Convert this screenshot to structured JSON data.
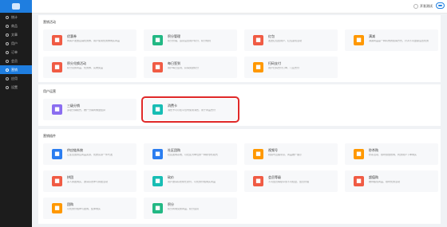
{
  "sidebar": {
    "items": [
      "统计",
      "商品",
      "文章",
      "用户",
      "订单",
      "会员",
      "营销",
      "应用",
      "设置"
    ],
    "active_index": 6
  },
  "topbar": {
    "user_label": "开发测试"
  },
  "sections": [
    {
      "title": "营销活动",
      "cards": [
        {
          "title": "优惠券",
          "desc": "向客户发放店铺优惠券，用户使用优惠券购买商品",
          "color": "#f05b44",
          "icon": "coupon-icon"
        },
        {
          "title": "积分管理",
          "desc": "积分管理，运营设置用户积分，积分规则",
          "color": "#22b884",
          "icon": "points-icon"
        },
        {
          "title": "红包",
          "desc": "发送红包给用户，红包返现活动",
          "color": "#f05b44",
          "icon": "red-packet-icon"
        },
        {
          "title": "满减",
          "desc": "满减商品是一种有效的促销方式，针对不同金额设置优惠",
          "color": "#ff9800",
          "icon": "full-reduction-icon"
        },
        {
          "title": "积分兑换活动",
          "desc": "积分兑换商品、优惠券、实物奖品",
          "color": "#f05b44",
          "icon": "exchange-icon"
        },
        {
          "title": "每日签到",
          "desc": "用户每日签到，获得奖励积分",
          "color": "#f05b44",
          "icon": "sign-in-icon"
        },
        {
          "title": "扫码支付",
          "desc": "用户扫码支付订单，门店支付",
          "color": "#ff9800",
          "icon": "scan-pay-icon"
        }
      ]
    },
    {
      "title": "用户运营",
      "cards": [
        {
          "title": "三级分销",
          "desc": "多级分销模式，推广分销商佣金结算",
          "color": "#8a6df0",
          "icon": "distribution-icon"
        },
        {
          "title": "消费卡",
          "desc": "消费卡可以在平台内使用消费，用于商品支付",
          "color": "#17bdb4",
          "icon": "consumption-card-icon"
        }
      ]
    },
    {
      "title": "营销插件",
      "cards": [
        {
          "title": "供应链系统",
          "desc": "汇集全国供应商品资源，优质货源一件代发",
          "color": "#2a7df0",
          "icon": "supply-chain-icon"
        },
        {
          "title": "社区团购",
          "desc": "社区团购系统，以社区为单位的一种新零售模式",
          "color": "#2a7df0",
          "icon": "community-icon"
        },
        {
          "title": "视频号",
          "desc": "视频号直播带货，商品推广展示",
          "color": "#ff9800",
          "icon": "video-icon"
        },
        {
          "title": "秒杀购",
          "desc": "秒杀活动，限时限量抢购，刺激用户下单购买",
          "color": "#ff9800",
          "icon": "flash-sale-icon"
        },
        {
          "title": "拼团",
          "desc": "多人拼团购买，邀请好友参与拼团活动",
          "color": "#f05b44",
          "icon": "group-buy-icon"
        },
        {
          "title": "砍价",
          "desc": "用户邀请好友帮忙砍价，以优惠价格购买商品",
          "color": "#17bdb4",
          "icon": "bargain-icon"
        },
        {
          "title": "会员等级",
          "desc": "不同会员等级享受不同权益，会员管理",
          "color": "#f05b44",
          "icon": "member-level-icon"
        },
        {
          "title": "超值购",
          "desc": "推荐超值商品，限时优惠活动",
          "color": "#f05b44",
          "icon": "value-buy-icon"
        },
        {
          "title": "团购",
          "desc": "以优惠价格参与团购，集体购买",
          "color": "#ff9800",
          "icon": "tuan-icon"
        },
        {
          "title": "积分",
          "desc": "积分商城兑换商品，积分运营",
          "color": "#22b884",
          "icon": "score-icon"
        }
      ]
    }
  ]
}
